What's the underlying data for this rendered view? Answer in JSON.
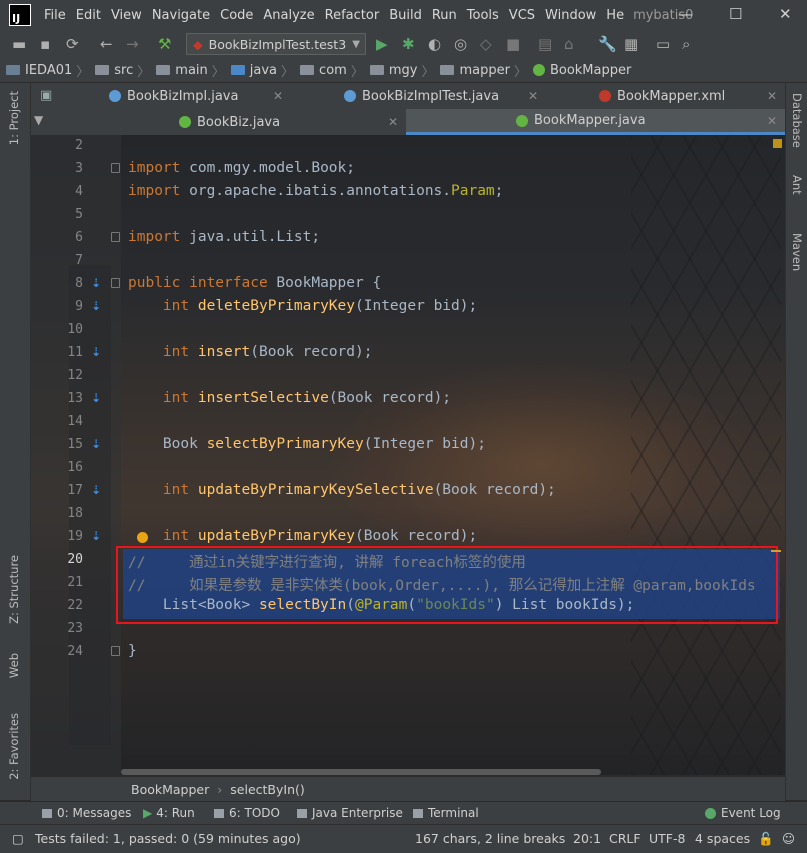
{
  "menubar": {
    "items": [
      "File",
      "Edit",
      "View",
      "Navigate",
      "Code",
      "Analyze",
      "Refactor",
      "Build",
      "Run",
      "Tools",
      "VCS",
      "Window",
      "He"
    ],
    "project_title": "mybatis0"
  },
  "toolbar": {
    "run_config": "BookBizImplTest.test3"
  },
  "breadcrumb": {
    "items": [
      "IEDA01",
      "src",
      "main",
      "java",
      "com",
      "mgy",
      "mapper",
      "BookMapper"
    ]
  },
  "tabs_row1": [
    {
      "label": "BookBizImpl.java",
      "icon_color": "#5d9bd5"
    },
    {
      "label": "BookBizImplTest.java",
      "icon_color": "#5d9bd5"
    },
    {
      "label": "BookMapper.xml",
      "icon_color": "#c0392b"
    }
  ],
  "tabs_row2": [
    {
      "label": "BookBiz.java",
      "icon_color": "#62b543"
    },
    {
      "label": "BookMapper.java",
      "icon_color": "#62b543"
    }
  ],
  "left_tool_tabs": [
    "1: Project",
    "Z: Structure",
    "Web",
    "2: Favorites"
  ],
  "right_tool_tabs": [
    "Database",
    "Ant",
    "Maven"
  ],
  "editor": {
    "lines": [
      {
        "n": "2",
        "code": []
      },
      {
        "n": "3",
        "code": [
          [
            "kw",
            "import"
          ],
          [
            "",
            " com.mgy.model.Book;"
          ]
        ]
      },
      {
        "n": "4",
        "code": [
          [
            "kw",
            "import"
          ],
          [
            "",
            " org.apache.ibatis.annotations."
          ],
          [
            "ann",
            "Param"
          ],
          [
            "",
            ";"
          ]
        ]
      },
      {
        "n": "5",
        "code": []
      },
      {
        "n": "6",
        "code": [
          [
            "kw",
            "import"
          ],
          [
            "",
            " java.util.List;"
          ]
        ]
      },
      {
        "n": "7",
        "code": []
      },
      {
        "n": "8",
        "code": [
          [
            "kw",
            "public interface"
          ],
          [
            "",
            " BookMapper {"
          ]
        ]
      },
      {
        "n": "9",
        "code": [
          [
            "",
            "    "
          ],
          [
            "kw",
            "int"
          ],
          [
            "",
            " "
          ],
          [
            "fn",
            "deleteByPrimaryKey"
          ],
          [
            "",
            "(Integer bid);"
          ]
        ]
      },
      {
        "n": "10",
        "code": []
      },
      {
        "n": "11",
        "code": [
          [
            "",
            "    "
          ],
          [
            "kw",
            "int"
          ],
          [
            "",
            " "
          ],
          [
            "fn",
            "insert"
          ],
          [
            "",
            "(Book record);"
          ]
        ]
      },
      {
        "n": "12",
        "code": []
      },
      {
        "n": "13",
        "code": [
          [
            "",
            "    "
          ],
          [
            "kw",
            "int"
          ],
          [
            "",
            " "
          ],
          [
            "fn",
            "insertSelective"
          ],
          [
            "",
            "(Book record);"
          ]
        ]
      },
      {
        "n": "14",
        "code": []
      },
      {
        "n": "15",
        "code": [
          [
            "",
            "    Book "
          ],
          [
            "fn",
            "selectByPrimaryKey"
          ],
          [
            "",
            "(Integer bid);"
          ]
        ]
      },
      {
        "n": "16",
        "code": []
      },
      {
        "n": "17",
        "code": [
          [
            "",
            "    "
          ],
          [
            "kw",
            "int"
          ],
          [
            "",
            " "
          ],
          [
            "fn",
            "updateByPrimaryKeySelective"
          ],
          [
            "",
            "(Book record);"
          ]
        ]
      },
      {
        "n": "18",
        "code": []
      },
      {
        "n": "19",
        "code": [
          [
            "",
            "    "
          ],
          [
            "kw",
            "int"
          ],
          [
            "",
            " "
          ],
          [
            "fn",
            "updateByPrimaryKey"
          ],
          [
            "",
            "(Book record);"
          ]
        ]
      },
      {
        "n": "20",
        "code": [
          [
            "cm",
            "//     通过in关键字进行查询, 讲解 foreach标签的使用"
          ]
        ]
      },
      {
        "n": "21",
        "code": [
          [
            "cm",
            "//     如果是参数 是非实体类(book,Order,....), 那么记得加上注解 @param,bookIds"
          ]
        ]
      },
      {
        "n": "22",
        "code": [
          [
            "",
            "    List<Book> "
          ],
          [
            "fn",
            "selectByIn"
          ],
          [
            "",
            "("
          ],
          [
            "ann",
            "@Param"
          ],
          [
            "",
            "("
          ],
          [
            "str",
            "\"bookIds\""
          ],
          [
            "",
            ") List bookIds);"
          ]
        ]
      },
      {
        "n": "23",
        "code": []
      },
      {
        "n": "24",
        "code": [
          [
            "",
            "}"
          ]
        ]
      }
    ]
  },
  "editor_breadcrumb": {
    "items": [
      "BookMapper",
      "selectByIn()"
    ]
  },
  "tool_windows": [
    {
      "label": "0: Messages"
    },
    {
      "label": "4: Run"
    },
    {
      "label": "6: TODO"
    },
    {
      "label": "Java Enterprise"
    },
    {
      "label": "Terminal"
    },
    {
      "label": "Event Log"
    }
  ],
  "status": {
    "message": "Tests failed: 1, passed: 0 (59 minutes ago)",
    "selection": "167 chars, 2 line breaks",
    "position": "20:1",
    "line_ending": "CRLF",
    "encoding": "UTF-8",
    "indent": "4 spaces"
  }
}
